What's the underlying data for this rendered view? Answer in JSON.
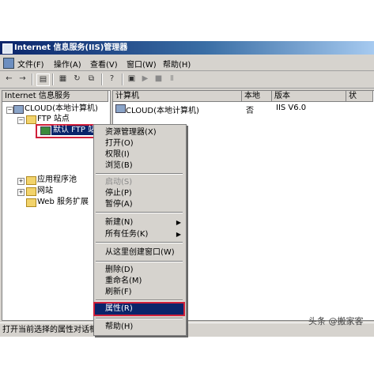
{
  "window": {
    "title": "Internet 信息服务(IIS)管理器"
  },
  "menu": [
    "文件(F)",
    "操作(A)",
    "查看(V)",
    "窗口(W)",
    "帮助(H)"
  ],
  "toolbar_icons": [
    "back-icon",
    "forward-icon",
    "show-tree-icon",
    "properties-icon",
    "refresh-icon",
    "export-icon",
    "help-icon",
    "computer-icon",
    "play-icon",
    "stop-icon",
    "pause-icon"
  ],
  "tree": {
    "root": "Internet 信息服务",
    "computer": "CLOUD(本地计算机)",
    "ftp_sites": "FTP 站点",
    "default_ftp": "默认 FTP 站",
    "app_pools": "应用程序池",
    "websites": "网站",
    "web_ext": "Web 服务扩展"
  },
  "list": {
    "headers": [
      "计算机",
      "本地",
      "版本",
      "状"
    ],
    "rows": [
      {
        "computer": "CLOUD(本地计算机)",
        "local": "否",
        "version": "IIS V6.0"
      }
    ]
  },
  "context_menu": {
    "items": [
      {
        "label": "资源管理器(X)"
      },
      {
        "label": "打开(O)"
      },
      {
        "label": "权限(I)"
      },
      {
        "label": "浏览(B)"
      },
      {
        "label": "启动(S)",
        "disabled": true
      },
      {
        "label": "停止(P)"
      },
      {
        "label": "暂停(A)"
      },
      {
        "label": "新建(N)",
        "submenu": true
      },
      {
        "label": "所有任务(K)",
        "submenu": true
      },
      {
        "label": "从这里创建窗口(W)"
      },
      {
        "label": "删除(D)"
      },
      {
        "label": "重命名(M)"
      },
      {
        "label": "刷新(F)"
      },
      {
        "label": "属性(R)",
        "highlighted": true
      },
      {
        "label": "帮助(H)"
      }
    ]
  },
  "status": "打开当前选择的属性对话框",
  "watermark": "头条 @搬家客",
  "colors": {
    "titlebar": "#0a246a",
    "highlight": "#0a246a",
    "annotation": "#d0203a",
    "chrome": "#d6d3ce"
  }
}
